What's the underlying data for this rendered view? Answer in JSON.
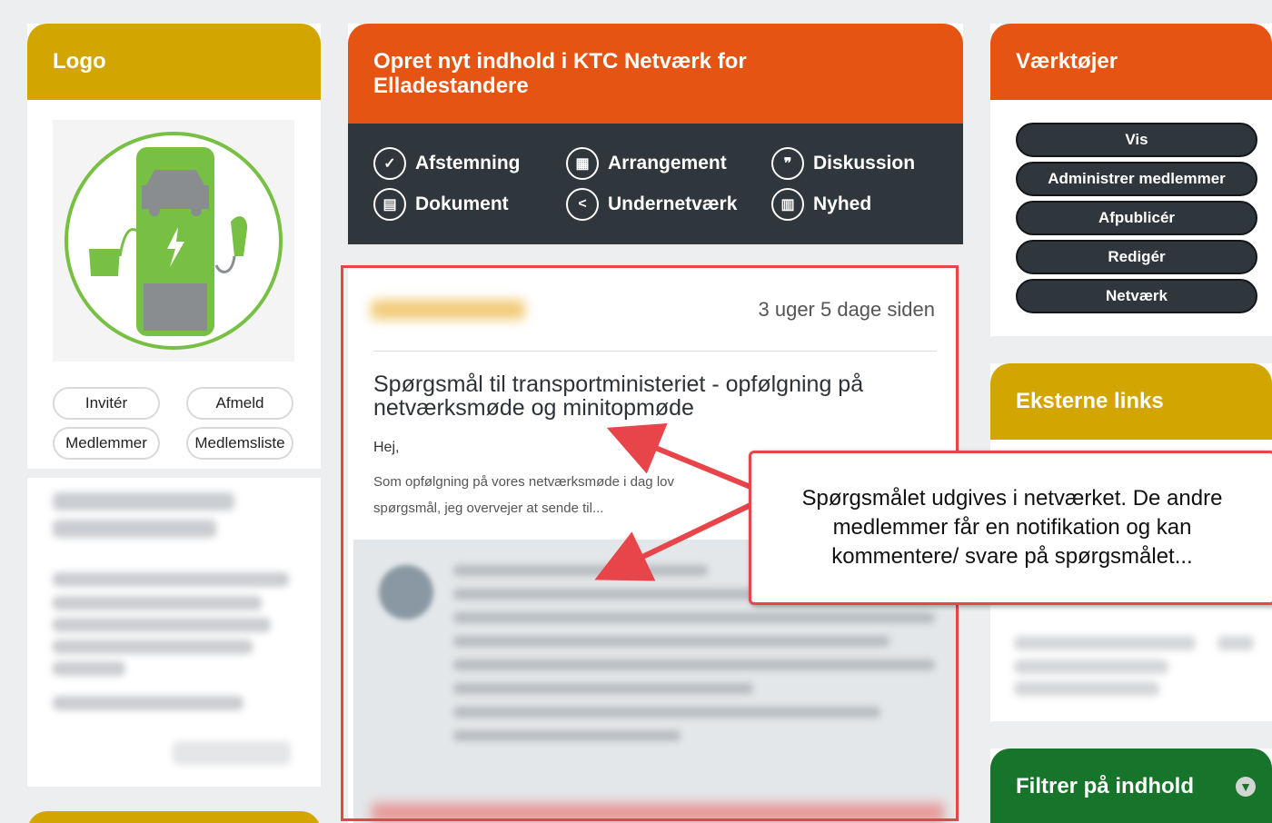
{
  "logo_panel": {
    "title": "Logo",
    "buttons": [
      "Invitér",
      "Afmeld",
      "Medlemmer",
      "Medlemsliste"
    ]
  },
  "create_panel": {
    "title": "Opret nyt indhold i KTC Netværk for Elladestandere",
    "content_types": [
      {
        "label": "Afstemning",
        "icon": "check-circle-icon"
      },
      {
        "label": "Arrangement",
        "icon": "calendar-icon"
      },
      {
        "label": "Diskussion",
        "icon": "chat-icon"
      },
      {
        "label": "Dokument",
        "icon": "document-icon"
      },
      {
        "label": "Undernetværk",
        "icon": "share-icon"
      },
      {
        "label": "Nyhed",
        "icon": "newspaper-icon"
      }
    ]
  },
  "post": {
    "timestamp": "3 uger 5 dage siden",
    "title": "Spørgsmål til transportministeriet - opfølgning på netværksmøde og minitopmøde",
    "greeting": "Hej,",
    "excerpt_line1": "Som opfølgning på vores netværksmøde i dag lov",
    "excerpt_line2": "spørgsmål, jeg overvejer at sende til..."
  },
  "tools_panel": {
    "title": "Værktøjer",
    "buttons": [
      "Vis",
      "Administrer medlemmer",
      "Afpublicér",
      "Redigér",
      "Netværk"
    ]
  },
  "links_panel": {
    "title": "Eksterne links"
  },
  "filter_panel": {
    "title": "Filtrer på indhold"
  },
  "callout": {
    "text": "Spørgsmålet udgives i netværket. De andre medlemmer får en notifikation og kan kommentere/ svare på spørgsmålet..."
  },
  "colors": {
    "yellow": "#d2a500",
    "orange": "#e55412",
    "green": "#17742b",
    "dark": "#2f363c",
    "annotation_red": "#e8454b",
    "logo_green": "#77c043"
  }
}
